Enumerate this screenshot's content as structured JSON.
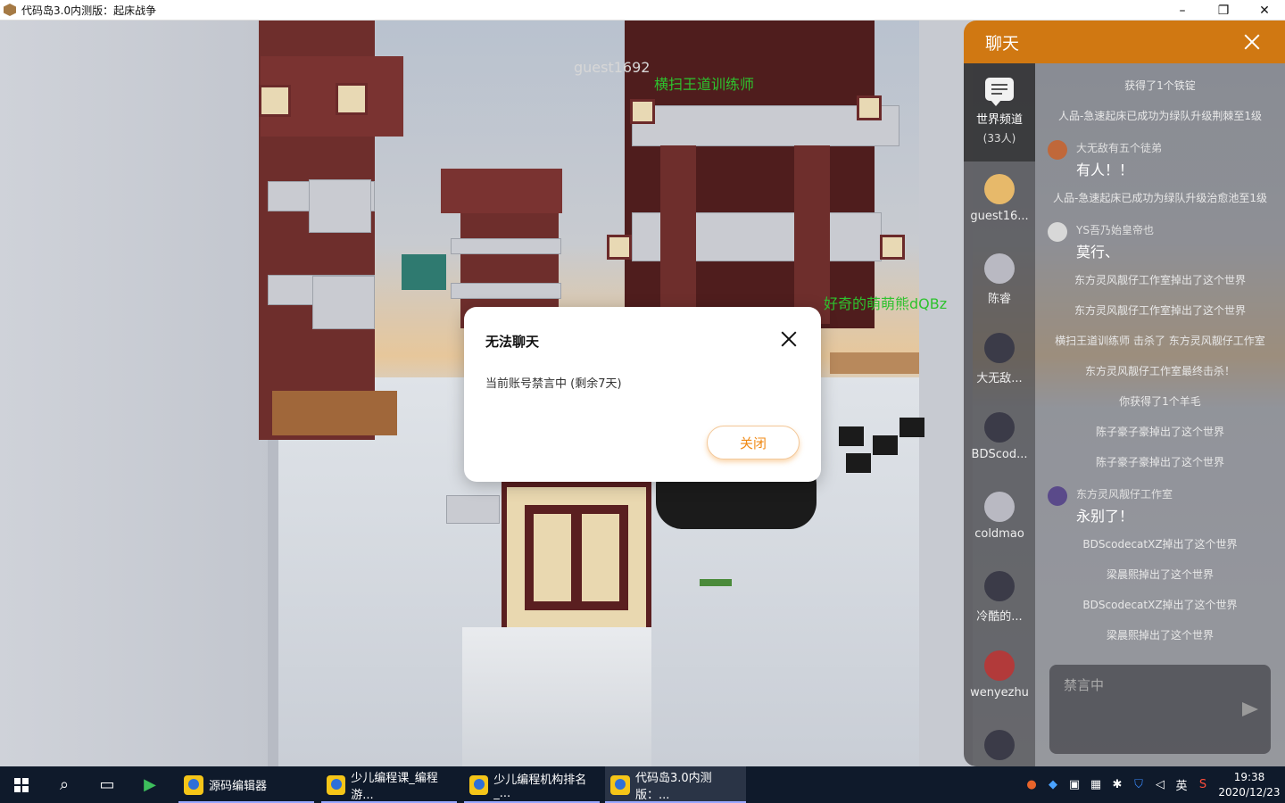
{
  "window": {
    "title": "代码岛3.0内测版：起床战争",
    "minimize": "–",
    "maximize": "❐",
    "close": "✕"
  },
  "game": {
    "player_names": [
      {
        "text": "guest1692",
        "color": "grey"
      },
      {
        "text": "横扫王道训练师",
        "color": "green"
      },
      {
        "text": "好奇的萌萌熊dQBz",
        "color": "green"
      }
    ]
  },
  "modal": {
    "title": "无法聊天",
    "message": "当前账号禁言中 (剩余7天)",
    "close_button": "关闭"
  },
  "chat": {
    "title": "聊天",
    "channels": {
      "world": {
        "name": "世界频道",
        "count": "(33人)"
      },
      "users": [
        {
          "name": "guest16...",
          "avatar_color": "#e7b96a"
        },
        {
          "name": "陈睿",
          "avatar_color": "#b9b9c2"
        },
        {
          "name": "大无敌...",
          "avatar_color": "#3b3b48"
        },
        {
          "name": "BDScod...",
          "avatar_color": "#3b3b48"
        },
        {
          "name": "coldmao",
          "avatar_color": "#b9b9c2"
        },
        {
          "name": "冷酷的...",
          "avatar_color": "#3b3b48"
        },
        {
          "name": "wenyezhu",
          "avatar_color": "#b23a3a"
        },
        {
          "name": "",
          "avatar_color": "#3b3b48"
        }
      ]
    },
    "messages": [
      {
        "kind": "system",
        "text": "获得了1个铁锭"
      },
      {
        "kind": "system",
        "text": "人品-急速起床已成功为绿队升级荆棘至1级"
      },
      {
        "kind": "user",
        "name": "大无敌有五个徒弟",
        "text": "有人！！",
        "avatar_color": "#c0683a"
      },
      {
        "kind": "system",
        "text": "人品-急速起床已成功为绿队升级治愈池至1级"
      },
      {
        "kind": "user",
        "name": "YS吾乃始皇帝也",
        "text": "莫行、",
        "avatar_color": "#d8d8d8"
      },
      {
        "kind": "system",
        "text": "东方灵风靓仔工作室掉出了这个世界"
      },
      {
        "kind": "system",
        "text": "东方灵风靓仔工作室掉出了这个世界"
      },
      {
        "kind": "system",
        "text": "横扫王道训练师 击杀了 东方灵风靓仔工作室"
      },
      {
        "kind": "system",
        "text": "东方灵风靓仔工作室最终击杀！"
      },
      {
        "kind": "system",
        "text": "你获得了1个羊毛"
      },
      {
        "kind": "system",
        "text": "陈子豪子豪掉出了这个世界"
      },
      {
        "kind": "system",
        "text": "陈子豪子豪掉出了这个世界"
      },
      {
        "kind": "user",
        "name": "东方灵风靓仔工作室",
        "text": "永别了！",
        "avatar_color": "#5a4a8a"
      },
      {
        "kind": "system",
        "text": "BDScodecatXZ掉出了这个世界"
      },
      {
        "kind": "system",
        "text": "梁晨熙掉出了这个世界"
      },
      {
        "kind": "system",
        "text": "BDScodecatXZ掉出了这个世界"
      },
      {
        "kind": "system",
        "text": "梁晨熙掉出了这个世界"
      }
    ],
    "input_placeholder": "禁言中"
  },
  "taskbar": {
    "apps": [
      {
        "label": "源码编辑器",
        "active": false
      },
      {
        "label": "少儿编程课_编程游...",
        "active": false
      },
      {
        "label": "少儿编程机构排名_...",
        "active": false
      },
      {
        "label": "代码岛3.0内测版：...",
        "active": true
      }
    ],
    "ime": "英",
    "time": "19:38",
    "date": "2020/12/23"
  }
}
